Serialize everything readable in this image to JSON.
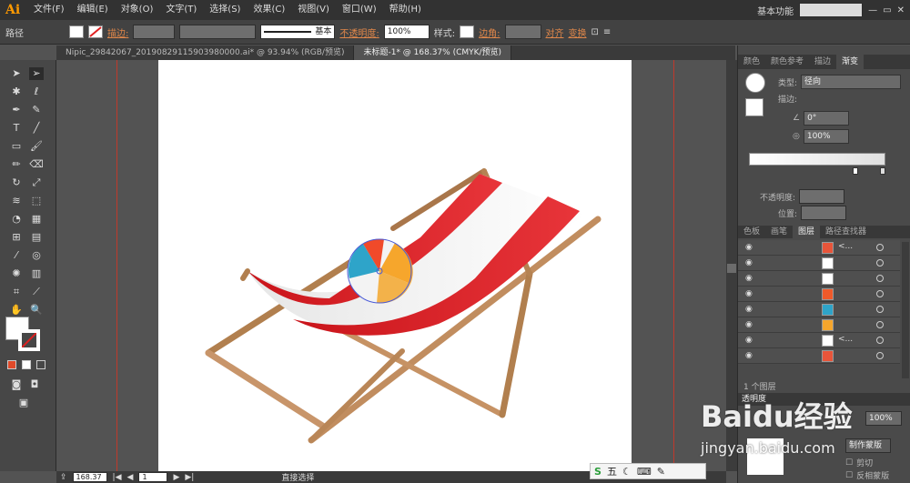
{
  "app": {
    "logo": "Ai",
    "workspace": "基本功能"
  },
  "menu": [
    "文件(F)",
    "编辑(E)",
    "对象(O)",
    "文字(T)",
    "选择(S)",
    "效果(C)",
    "视图(V)",
    "窗口(W)",
    "帮助(H)"
  ],
  "control": {
    "selection_label": "路径",
    "stroke_label": "描边:",
    "brush_label": "基本",
    "opacity_label": "不透明度:",
    "opacity_value": "100%",
    "style_label": "样式:",
    "corner_label": "边角:",
    "align_label": "对齐",
    "transform_label": "变换"
  },
  "tabs": [
    "Nipic_29842067_20190829115903980000.ai* @ 93.94% (RGB/预览)",
    "未标题-1* @ 168.37% (CMYK/预览)"
  ],
  "status": {
    "zoom": "168.37",
    "page": "1",
    "tool": "直接选择"
  },
  "gradient_panel": {
    "tabs": [
      "颜色",
      "颜色参考",
      "描边",
      "渐变"
    ],
    "type_label": "类型:",
    "type_value": "径向",
    "stroke_label": "描边:",
    "angle_value": "0°",
    "aspect_value": "100%",
    "opacity_label": "不透明度:",
    "position_label": "位置:"
  },
  "layers_panel": {
    "tabs": [
      "色板",
      "画笔",
      "图层",
      "路径查找器"
    ],
    "footer": "1 个图层",
    "rows": [
      "<...",
      "",
      "",
      "",
      "",
      "",
      "<...",
      ""
    ]
  },
  "transparency": {
    "tab": "透明度",
    "opacity": "100%",
    "make_mask": "制作蒙版",
    "clip": "剪切",
    "invert": "反相蒙版"
  },
  "watermark": {
    "brand": "Baidu经验",
    "url": "jingyan.baidu.com"
  },
  "ime": "五"
}
